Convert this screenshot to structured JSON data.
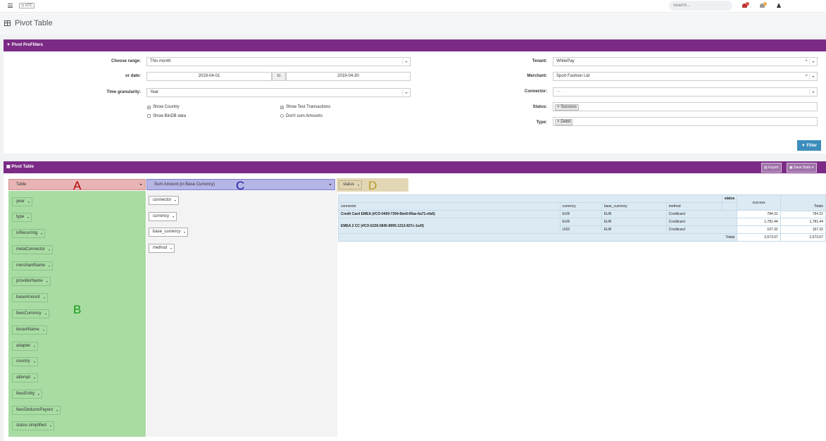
{
  "topbar": {
    "utc": "UTC",
    "search_placeholder": "Search...",
    "icons": [
      "menu-icon",
      "bell-icon",
      "bell-icon",
      "warning-icon"
    ],
    "colors": {
      "badge_red": "#d9534f",
      "badge_orange": "#f0ad4e"
    }
  },
  "page": {
    "title": "Pivot Table"
  },
  "filters": {
    "header": "Pivot ProFilters",
    "range_label": "Choose range:",
    "range_value": "This month",
    "date_label": "or date:",
    "date_from": "2019-04-01",
    "date_to_label": "to",
    "date_to": "2019-04-30",
    "granularity_label": "Time granularity:",
    "granularity_value": "Year",
    "show_country": "Show Country",
    "show_bindb": "Show BinDB data",
    "show_test": "Show Test Transactions",
    "dont_sum": "Don't sum Amounts",
    "tenant_label": "Tenant:",
    "tenant_value": "WhitePay",
    "merchant_label": "Merchant:",
    "merchant_value": "Sport Fashion Ltd",
    "connector_label": "Connector:",
    "connector_value": "---",
    "status_label": "Status:",
    "status_tag": "Success",
    "type_label": "Type:",
    "type_tag": "Debit",
    "filter_button": "Filter",
    "colors": {
      "header": "#7b2b86",
      "primary": "#3c8dbc"
    }
  },
  "pivot_panel": {
    "header": "Pivot Table",
    "export_button": "Export",
    "save_state_button": "Save State"
  },
  "pivot": {
    "renderer": "Table",
    "aggregator": "Sum Amount (in Base Currency)",
    "letters": {
      "a": "A",
      "b": "B",
      "c": "C",
      "d": "D"
    },
    "cols": [
      "status"
    ],
    "rows": [
      "connector",
      "currency",
      "base_currency",
      "method"
    ],
    "unused": [
      "year",
      "type",
      "isRecurring",
      "metaConnector",
      "merchantName",
      "providerName",
      "baseAmount",
      "feesCurrency",
      "tenantName",
      "adapter",
      "country",
      "attempt",
      "feesEntity",
      "feesDeductsPayout",
      "status simplified"
    ],
    "colors": {
      "unused": "#a8dca3",
      "renderer": "#e8b4b4",
      "aggregator": "#b5b5e6",
      "cols": "#e2d6b4",
      "table_header": "#dceaf3"
    }
  },
  "table": {
    "col_attr": "status",
    "headers": [
      "connector",
      "currency",
      "base_currency",
      "method"
    ],
    "col_value": "success",
    "totals_label": "Totals",
    "rows": [
      {
        "connector": "Credit Card EMEA (#CO-0469-7394-6be8-09ae-6a71-efa6)",
        "currency": "EUR",
        "base_currency": "EUR",
        "method": "Creditcard",
        "value": "784.31",
        "total": "784.31"
      },
      {
        "connector": "EMEA 2 CC (#CO-6228-5845-8995-1313-837c-1edf)",
        "currency": "EUR",
        "base_currency": "EUR",
        "method": "Creditcard",
        "value": "1,781.44",
        "total": "1,781.44"
      },
      {
        "connector": "",
        "currency": "USD",
        "base_currency": "EUR",
        "method": "Creditcard",
        "value": "167.32",
        "total": "167.32"
      }
    ],
    "grand_value": "2,673.07",
    "grand_total": "2,673.07"
  }
}
